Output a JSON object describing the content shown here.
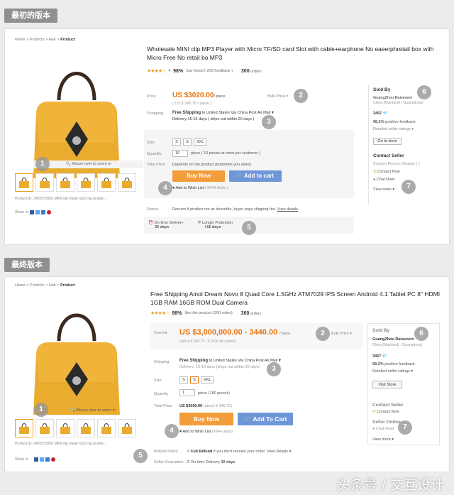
{
  "top": {
    "tag": "最初的版本",
    "breadcrumb": {
      "items": [
        "Home",
        "Prodrcts",
        "Hair"
      ],
      "current": "Product"
    },
    "title": "Wholesale MINI clip MP3 Player with Micro TF/SD card Slot with cable+earphone No eaeerphretail box with Micro Free  No retail bo MP3",
    "rating_pct": "98%",
    "rating_text": "Say Good ( 200 feedback )",
    "orders_num": "300",
    "orders_label": "orders",
    "price_label": "Price",
    "price": "US $3020.00",
    "price_unit": "/ piece",
    "price_sub": "( US $ 345.75 / piece )",
    "bulk_price": "Bulk Price",
    "shipping_label": "Shopping",
    "free_shipping": "Free Shipping",
    "shipping_to": "to United States Via China Post Air Mail",
    "delivery": "Delivery:15-16 days ( ships out within 20 days )",
    "size_label": "Size",
    "sizes": [
      "S",
      "S",
      "XXL"
    ],
    "quantity_label": "Quantity",
    "quantity_value": "10",
    "quantity_note": "piece  ( 10 pieces at most per customer )",
    "total_label": "Total Price",
    "total_value": "Depends on the product properties you select",
    "buy_now": "Buy Now",
    "add_to_cart": "Add to cart",
    "wish": "Add to Wish List",
    "wish_count": "( 6844 Adds )",
    "return_label": "Return",
    "return_text": "Returns if product not as describle, buyer pays shipping fee.",
    "view_details": "View details",
    "ontime": "On-time Delivery",
    "ontime_days": "30 days",
    "longer": "Longer Protection",
    "longer_days": "+15 days",
    "zoom": "Mouse over to zoom in",
    "product_id": "Product ID: 3425578305 MINI clip metal mp3 clip.mobile...",
    "share": "Share to",
    "seller": {
      "heading": "Sold By",
      "name": "GuangZhou Raisevern",
      "location": "China (Mainland) ( Guangdong)",
      "score": "3457",
      "feedback": "98.2%",
      "feedback_label": "positive feedback",
      "ratings": "Detailed seller ratings",
      "store_btn": "Go to store",
      "contact_heading": "Contact Seller",
      "contact_person": "Contact Person: Graphy ( )",
      "contact_now": "Contact Now",
      "chat_now": "Chat Now!",
      "view_more": "View more"
    },
    "badges": [
      "1",
      "2",
      "3",
      "4",
      "5",
      "6",
      "7"
    ]
  },
  "bottom": {
    "tag": "最终版本",
    "breadcrumb": {
      "items": [
        "Home",
        "Prodrcts",
        "Hair"
      ],
      "current": "Product"
    },
    "title": "Free Shipping Ainol Dream Novo 8 Quad Core 1.5GHz ATM7029 IPS Screen Android 4.1 Tablet PC 8\" HDMI 1GB RAM 16GB ROM Dual Camera",
    "rating_pct": "98%",
    "rating_text": "like this product (200 votes)",
    "orders_num": "300",
    "orders_label": "orders",
    "price_label": "Current",
    "price": "US $3,000,000.00 - 3440.00",
    "price_unit": "/ piece",
    "price_sub": "(about ¥ 345.75 - ¥ 2430.44 / piece)",
    "bulk_price": "Bulk Price",
    "shipping_label": "Shipping",
    "free_shipping": "Free Shipping",
    "shipping_to": "to United States Via China Post Air Mail",
    "delivery": "Delivery: 15-16 days (ships out within 20 days)",
    "size_label": "Size",
    "sizes": [
      "S",
      "S",
      "XXL"
    ],
    "quantity_label": "Quantity",
    "quantity_value": "1",
    "quantity_note": "piece  (180 pieces)",
    "total_label": "Total Price",
    "total_value": "US $3000.00",
    "total_about": "(about ¥ 345.75)",
    "buy_now": "Buy Now",
    "add_to_cart": "Add To Cart",
    "wish": "Add to Wish List",
    "wish_count": "(6844 adds)",
    "refund_label": "Refund Policy",
    "refund_bold": "Full Refund",
    "refund_text": "if you don't receive your order.",
    "view_details": "View Details",
    "guarantee_label": "Seller Guarantee",
    "ontime": "On-time Delivery",
    "ontime_days": "30 days",
    "zoom": "Mouse over to zoom in",
    "product_id": "Product ID: 3425578305 MINI clip metal mp3 clip.mobile...",
    "share": "Share to",
    "seller": {
      "heading": "Sold By",
      "name": "GuangZhou Raisevern",
      "location": "China (Mainland) ( Guangdong)",
      "score": "3457",
      "feedback": "98.2%",
      "feedback_label": "positive feedback",
      "ratings": "Detailed seller ratings",
      "store_btn": "Visit Store",
      "contact_heading": "Contact Seller",
      "contact_now": "Contact Now",
      "online_heading": "Seller Online",
      "chat_now": "Chat Now!",
      "view_more": "View more"
    },
    "badges": [
      "1",
      "2",
      "3",
      "4",
      "5",
      "6",
      "7"
    ]
  },
  "watermark": "头条号 / 交互设计",
  "colors": {
    "accent": "#e8730c",
    "buy": "#f39c3a",
    "cart": "#6f97d8",
    "tag": "#8f8f8f"
  }
}
